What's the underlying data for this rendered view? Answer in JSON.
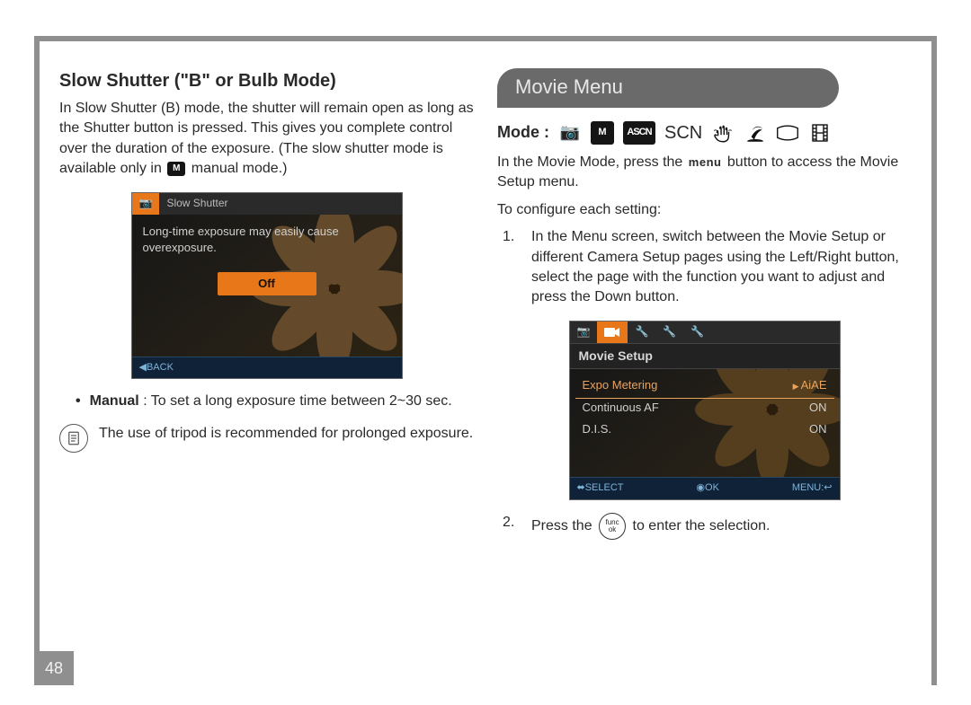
{
  "page_number": "48",
  "left": {
    "heading": "Slow Shutter (\"B\" or Bulb Mode)",
    "intro_a": "In Slow Shutter (B) mode, the shutter will remain open as long as the Shutter button is pressed. This gives you complete control over the duration of the exposure. (The slow shutter mode is available only in ",
    "intro_chip": "M",
    "intro_b": " manual mode.)",
    "lcd": {
      "tab1_icon": "📷",
      "title": "Slow Shutter",
      "message": "Long-time exposure may easily cause overexposure.",
      "off_label": "Off",
      "footer_back": "BACK"
    },
    "bullet_label": "Manual",
    "bullet_text": ": To set a long exposure time between 2~30 sec.",
    "tip_text": "The use of tripod is recommended for prolonged exposure."
  },
  "right": {
    "pill": "Movie Menu",
    "mode_label": "Mode :",
    "modes": {
      "camera": "📷",
      "m": "M",
      "ascn_square": "ASCN",
      "scn": "SCN",
      "hand": "✋",
      "beach": "🏖",
      "pano": "▭",
      "film": "🎞"
    },
    "mode_line_a": "In the Movie Mode, press the",
    "mode_line_menu": "menu",
    "mode_line_b": "button to access the Movie Setup menu.",
    "configure_line": "To configure each setting:",
    "step1": "In the Menu screen, switch between the Movie Setup or different Camera Setup pages using the Left/Right button, select the page with the function you want to adjust and press the Down button.",
    "lcd": {
      "setup_title": "Movie Setup",
      "rows": [
        {
          "label": "Expo Metering",
          "value": "AiAE",
          "selected": true
        },
        {
          "label": "Continuous AF",
          "value": "ON",
          "selected": false
        },
        {
          "label": "D.I.S.",
          "value": "ON",
          "selected": false
        }
      ],
      "foot_select": "SELECT",
      "foot_ok": "OK",
      "foot_menu": "MENU:"
    },
    "step2_a": "Press the",
    "step2_func_top": "func",
    "step2_func_bot": "ok",
    "step2_b": "to enter the selection."
  }
}
